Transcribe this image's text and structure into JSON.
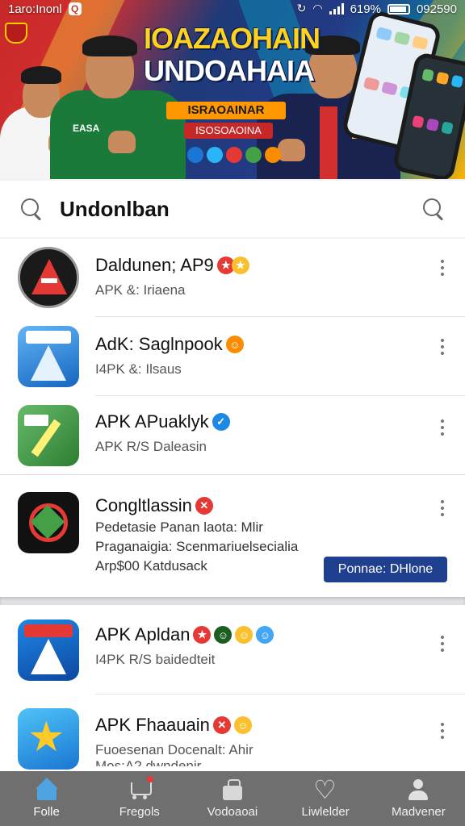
{
  "status_bar": {
    "carrier": "1aro:Inonl",
    "badge": "Q",
    "battery": "619%",
    "time": "092590"
  },
  "banner": {
    "title_line1": "IOAZAOHAIN",
    "title_line2": "UNDOAHAIA",
    "pill1": "ISRAOAINAR",
    "pill2": "ISOSOAOINA",
    "jersey_text": "EASA"
  },
  "search": {
    "title": "Undonlban"
  },
  "apps": [
    {
      "name": "Daldunen; AP9",
      "sub": "APK &: Iriaena",
      "badges": [
        "red-star",
        "yellow-star"
      ],
      "icon_color": "#c62828"
    },
    {
      "name": "AdK: Saglnpook",
      "sub": "I4PK &: Ilsaus",
      "badges": [
        "orange-face"
      ],
      "icon_color": "#1e88e5"
    },
    {
      "name": "APK APuaklyk",
      "sub": "APK R/S Daleasin",
      "badges": [
        "blue-check"
      ],
      "icon_color": "#43a047"
    },
    {
      "name": "Congltlassin",
      "sub_lines": [
        "Pedetasie Panan laota: Mlir",
        "Praganaigia: Scenmariuelsecialia",
        "Arp$00 Katdusack"
      ],
      "badges": [
        "red-x"
      ],
      "button": "Ponnae: DHlone",
      "icon_color": "#111111"
    },
    {
      "name": "APK Apldan",
      "sub": "I4PK R/S baidedteit",
      "badges": [
        "red-star",
        "dark-face",
        "yellow-face",
        "blue-face"
      ],
      "icon_color": "#1565c0"
    },
    {
      "name": "APK Fhaauain",
      "sub": "Fuoesenan Docenalt: Ahir",
      "sub2": "Mos:A? dwndenir",
      "badges": [
        "red-x",
        "yellow-face"
      ],
      "icon_color": "#2196f3"
    }
  ],
  "bottom_nav": [
    {
      "label": "Folle",
      "icon": "home-icon"
    },
    {
      "label": "Fregols",
      "icon": "cart-icon"
    },
    {
      "label": "Vodoaoai",
      "icon": "bag-icon"
    },
    {
      "label": "Liwlelder",
      "icon": "heart-icon"
    },
    {
      "label": "Madvener",
      "icon": "user-icon"
    }
  ]
}
